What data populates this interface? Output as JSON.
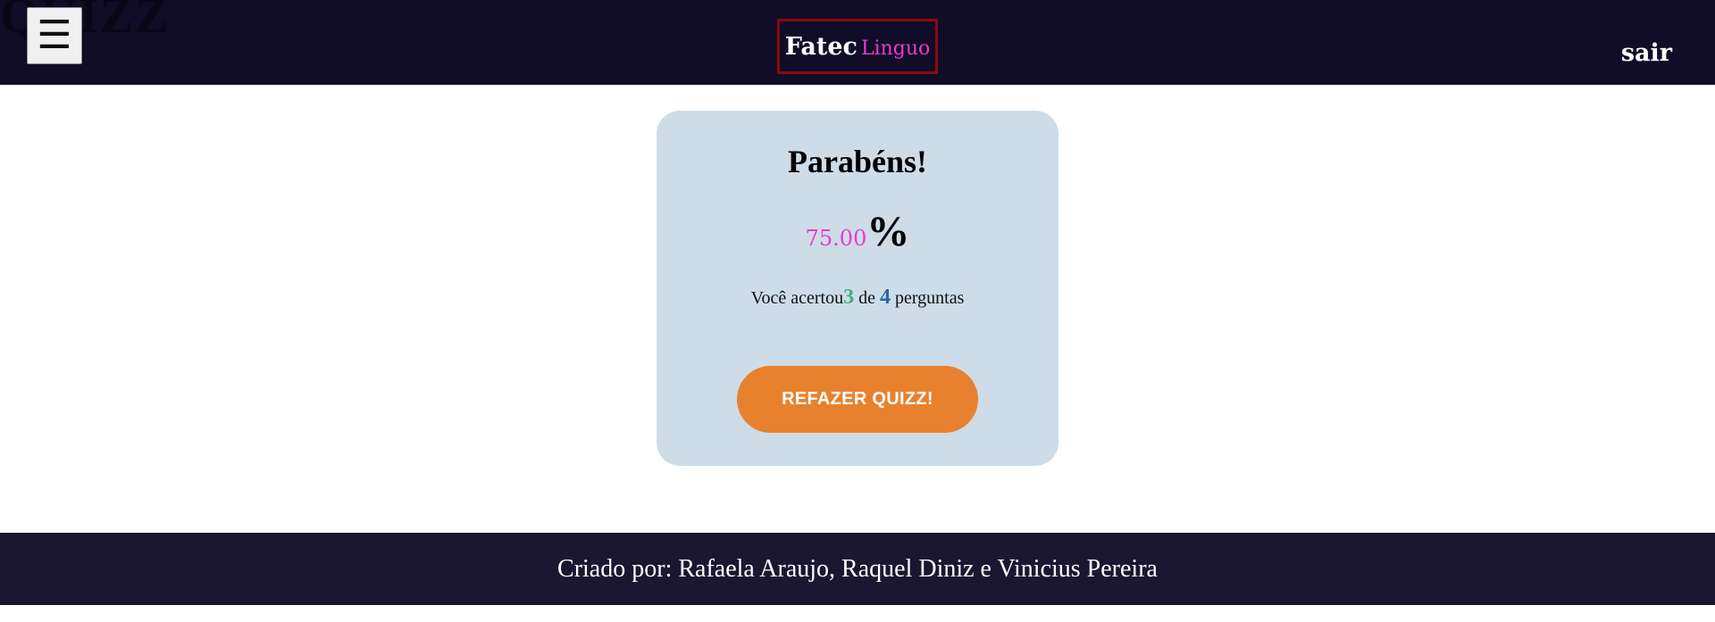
{
  "header": {
    "background_word": "QUIZZ",
    "menu_icon": "☰",
    "logo": {
      "part1": "Fatec",
      "part2": "Linguo"
    },
    "logout_label": "sair"
  },
  "result": {
    "title": "Parabéns!",
    "score_value": "75.00",
    "score_symbol": "%",
    "summary_prefix": "Você acertou",
    "correct_count": "3",
    "summary_middle": "de",
    "total_count": "4",
    "summary_suffix": "perguntas",
    "redo_button_label": "REFAZER QUIZZ!"
  },
  "footer": {
    "credits": "Criado por: Rafaela Araujo, Raquel Diniz e Vinicius Pereira"
  },
  "colors": {
    "header_bg": "#110c28",
    "footer_bg": "#1b1632",
    "card_bg": "#cddce7",
    "accent_pink": "#e83ad1",
    "button_orange": "#e8812e",
    "correct_green": "#3fb07a",
    "total_blue": "#2a66a8"
  }
}
